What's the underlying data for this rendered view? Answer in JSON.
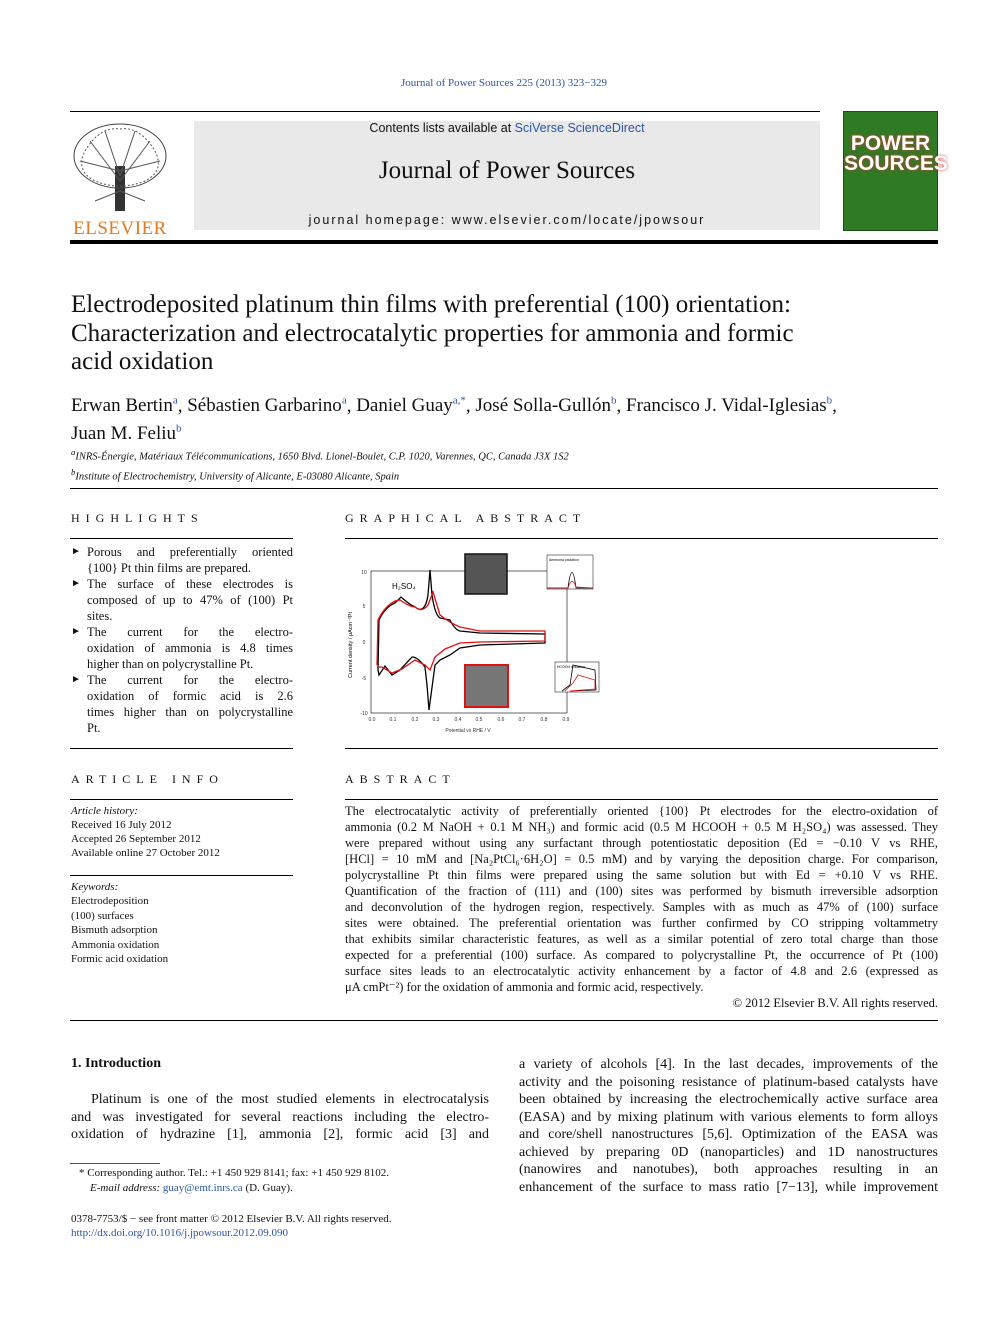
{
  "header": {
    "citation": "Journal of Power Sources 225 (2013) 323−329",
    "contents_prefix": "Contents lists available at ",
    "contents_link": "SciVerse ScienceDirect",
    "journal_title": "Journal of Power Sources",
    "homepage": "journal homepage: www.elsevier.com/locate/jpowsour",
    "publisher_logo": "ELSEVIER",
    "cover_text": "POWER SOURCES"
  },
  "article": {
    "title_lines": [
      "Electrodeposited platinum thin films with preferential (100) orientation:",
      "Characterization and electrocatalytic properties for ammonia and formic",
      "acid oxidation"
    ],
    "authors": [
      {
        "name": "Erwan Bertin",
        "sup": "a"
      },
      {
        "name": "Sébastien Garbarino",
        "sup": "a"
      },
      {
        "name": "Daniel Guay",
        "sup": "a,*"
      },
      {
        "name": "José Solla-Gullón",
        "sup": "b"
      },
      {
        "name": "Francisco J. Vidal-Iglesias",
        "sup": "b"
      },
      {
        "name": "Juan M. Feliu",
        "sup": "b"
      }
    ],
    "affiliations": [
      {
        "sup": "a",
        "text": "INRS-Énergie, Matériaux Télécommunications, 1650 Blvd. Lionel-Boulet, C.P. 1020, Varennes, QC, Canada J3X 1S2"
      },
      {
        "sup": "b",
        "text": "Institute of Electrochemistry, University of Alicante, E-03080 Alicante, Spain"
      }
    ]
  },
  "highlights": {
    "heading": "HIGHLIGHTS",
    "items": [
      [
        "Porous and preferentially oriented",
        "{100} Pt thin films are prepared."
      ],
      [
        "The surface of these electrodes is",
        "composed of up to 47% of (100) Pt",
        "sites."
      ],
      [
        "The current for the electro-",
        "oxidation of ammonia is 4.8 times",
        "higher than on polycrystalline Pt."
      ],
      [
        "The current for the electro-",
        "oxidation of formic acid is 2.6",
        "times higher than on polycrystalline",
        "Pt."
      ]
    ]
  },
  "graphical_abstract": {
    "heading": "GRAPHICAL ABSTRACT",
    "ylabel": "Current density / μAcm⁻²Pt",
    "xlabel": "Potential vs RHE / V",
    "electrolyte": "H₂SO₄",
    "xticks": [
      "0.0",
      "0.1",
      "0.2",
      "0.3",
      "0.4",
      "0.5",
      "0.6",
      "0.7",
      "0.8",
      "0.9"
    ],
    "yticks": [
      "10",
      "5",
      "0",
      "-5",
      "-10"
    ],
    "inset1_label": "Ammonia oxidation",
    "inset2_label": "HCOOH oxidation",
    "colors": {
      "series1": "#000000",
      "series2": "#e01010"
    }
  },
  "article_info": {
    "heading": "ARTICLE INFO",
    "history_label": "Article history:",
    "history": [
      "Received 16 July 2012",
      "Accepted 26 September 2012",
      "Available online 27 October 2012"
    ],
    "keywords_label": "Keywords:",
    "keywords": [
      "Electrodeposition",
      "(100) surfaces",
      "Bismuth adsorption",
      "Ammonia oxidation",
      "Formic acid oxidation"
    ]
  },
  "abstract": {
    "heading": "ABSTRACT",
    "lines": [
      "The electrocatalytic activity of preferentially oriented {100} Pt electrodes for the electro-oxidation of",
      "ammonia (0.2 M NaOH + 0.1 M NH₃) and formic acid (0.5 M HCOOH + 0.5 M H₂SO₄) was assessed. They",
      "were prepared without using any surfactant through potentiostatic deposition (Ed = −0.10 V vs RHE,",
      "[HCl] = 10 mM and [Na₂PtCl₆·6H₂O] = 0.5 mM) and by varying the deposition charge. For comparison,",
      "polycrystalline Pt thin films were prepared using the same solution but with Ed = +0.10 V vs RHE.",
      "Quantification of the fraction of (111) and (100) sites was performed by bismuth irreversible adsorption",
      "and deconvolution of the hydrogen region, respectively. Samples with as much as 47% of (100) surface",
      "sites were obtained. The preferential orientation was further confirmed by CO stripping voltammetry",
      "that exhibits similar characteristic features, as well as a similar potential of zero total charge than those",
      "expected for a preferential (100) surface. As compared to polycrystalline Pt, the occurrence of Pt (100)",
      "surface sites leads to an electrocatalytic activity enhancement by a factor of 4.8 and 2.6 (expressed as",
      "μA cmPt⁻²) for the oxidation of ammonia and formic acid, respectively."
    ],
    "copyright": "© 2012 Elsevier B.V. All rights reserved."
  },
  "intro": {
    "heading": "1.  Introduction",
    "left_lines": [
      "Platinum is one of the most studied elements in electrocatalysis",
      "and was investigated for several reactions including the electro-",
      "oxidation of hydrazine [1], ammonia [2], formic acid [3] and"
    ],
    "right_lines": [
      "a variety of alcohols [4]. In the last decades, improvements of the",
      "activity and the poisoning resistance of platinum-based catalysts have",
      "been obtained by increasing the electrochemically active surface area",
      "(EASA) and by mixing platinum with various elements to form alloys",
      "and core/shell nanostructures [5,6]. Optimization of the EASA was",
      "achieved by preparing 0D (nanoparticles) and 1D nanostructures",
      "(nanowires and nanotubes), both approaches resulting in an",
      "enhancement of the surface to mass ratio [7−13], while improvement"
    ]
  },
  "footnote": {
    "corresponding": "* Corresponding author. Tel.: +1 450 929 8141; fax: +1 450 929 8102.",
    "email_label": "E-mail address: ",
    "email": "guay@emt.inrs.ca",
    "email_suffix": " (D. Guay)."
  },
  "footer": {
    "issn": "0378-7753/$ − see front matter © 2012 Elsevier B.V. All rights reserved.",
    "doi": "http://dx.doi.org/10.1016/j.jpowsour.2012.09.090"
  }
}
